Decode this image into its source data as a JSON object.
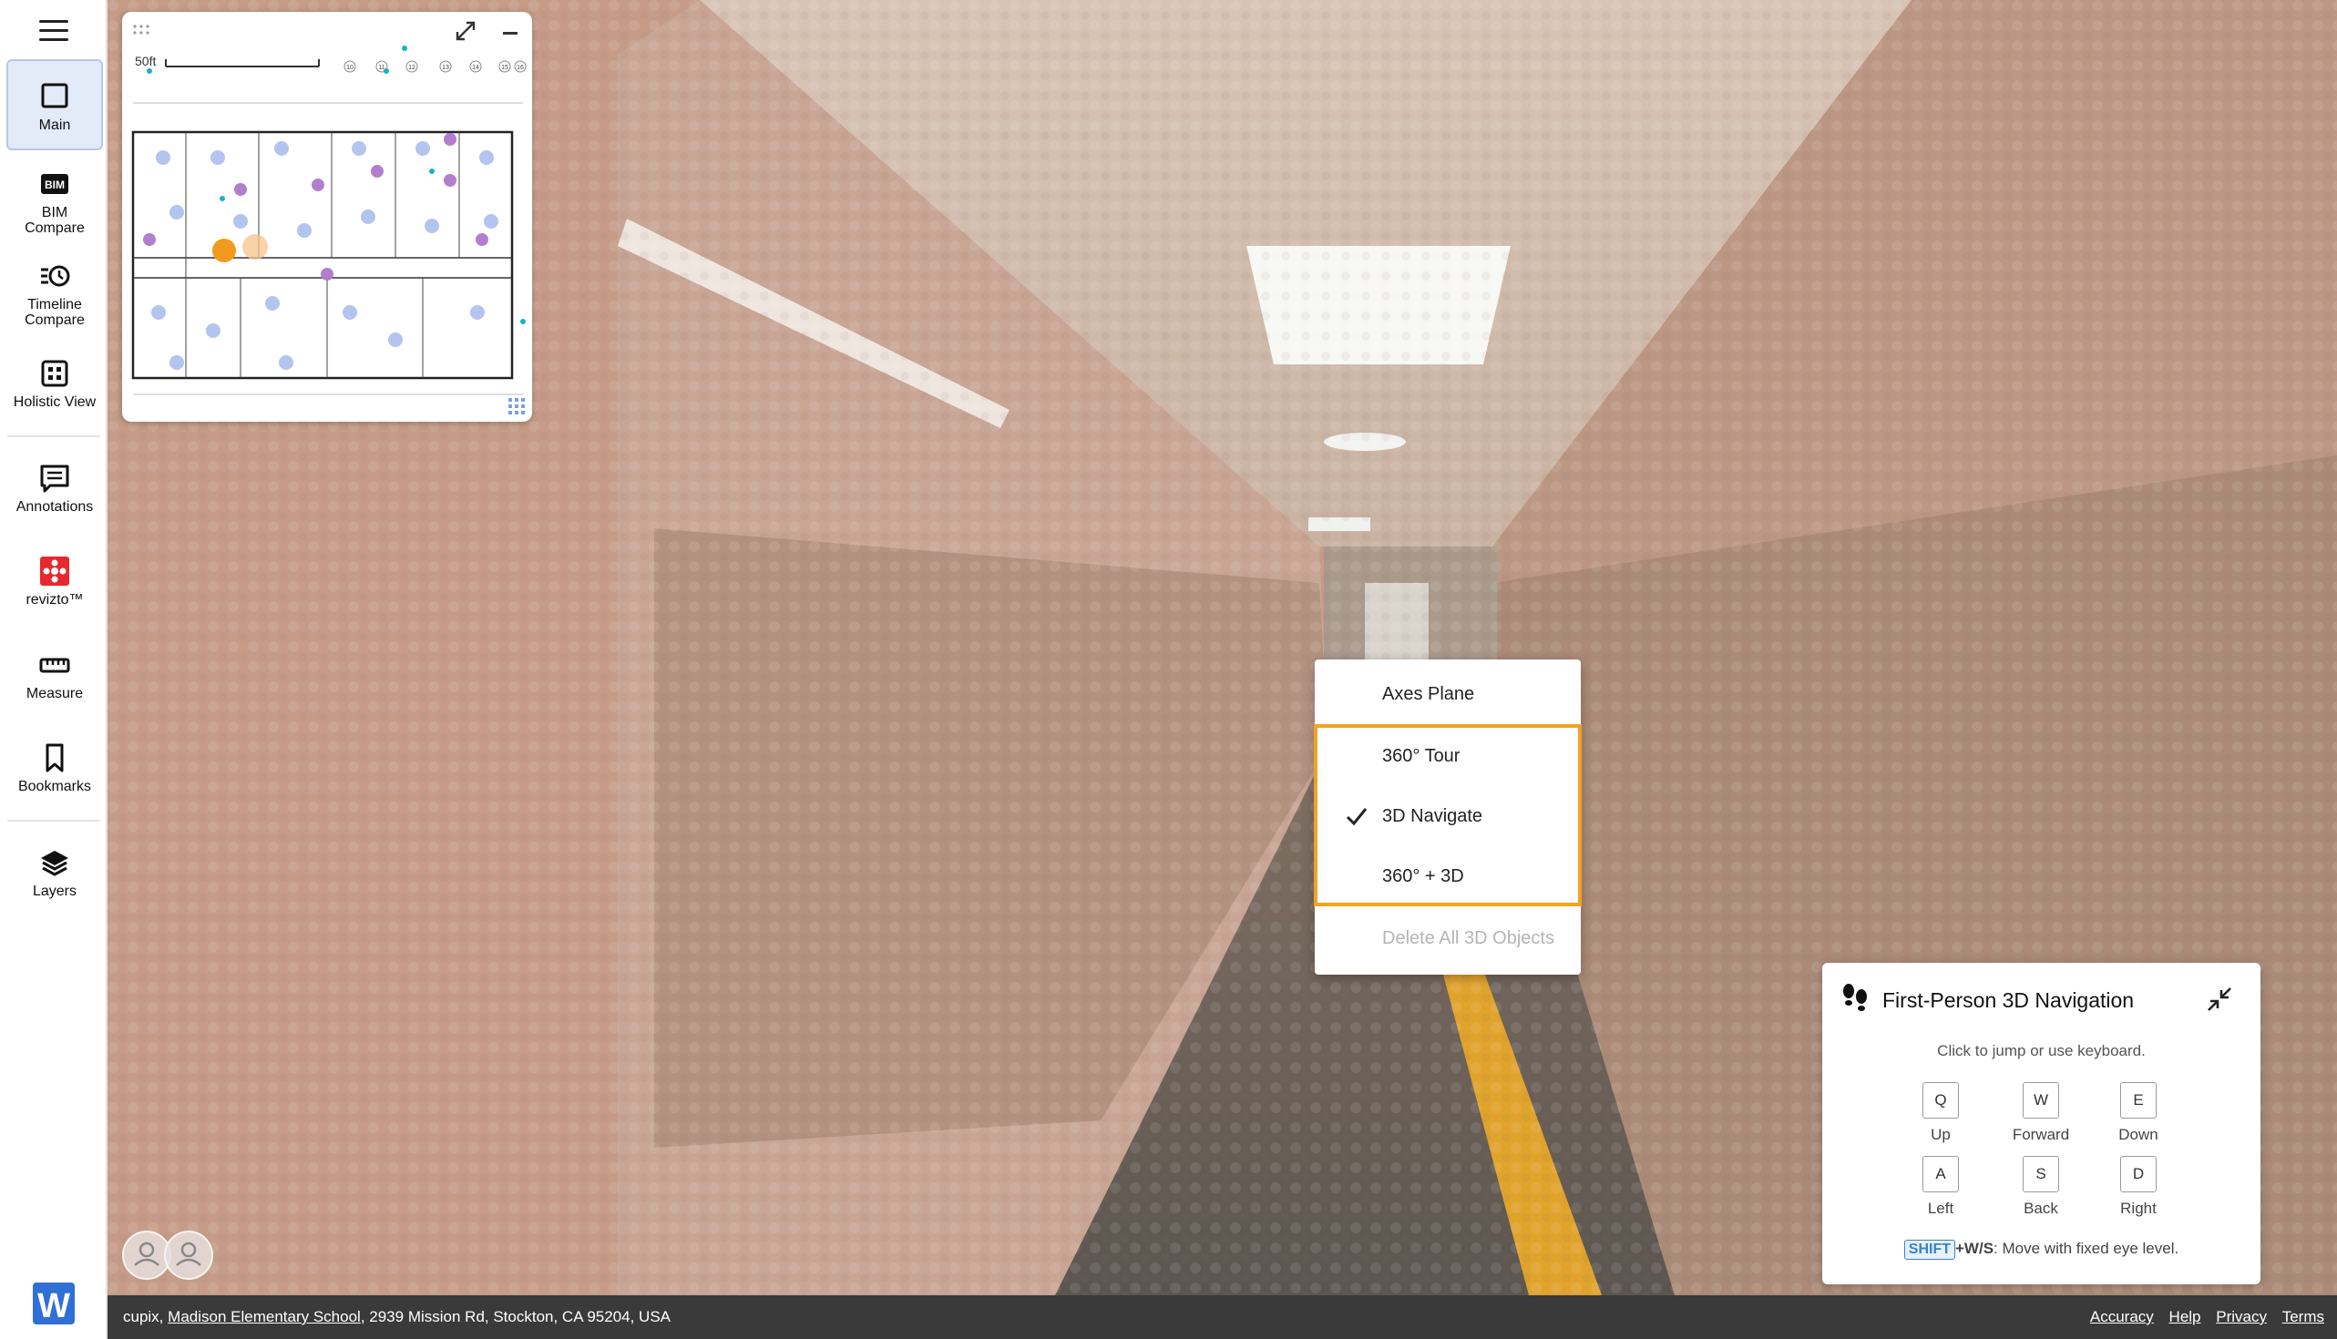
{
  "sidebar": {
    "items": [
      {
        "label": "Main",
        "icon": "square-icon"
      },
      {
        "label": "BIM\nCompare",
        "icon": "bim-icon",
        "badge": "BIM"
      },
      {
        "label": "Timeline\nCompare",
        "icon": "timeline-icon"
      },
      {
        "label": "Holistic View",
        "icon": "grid-icon"
      },
      {
        "label": "Annotations",
        "icon": "annotation-icon"
      },
      {
        "label": "revizto™",
        "icon": "revizto-icon"
      },
      {
        "label": "Measure",
        "icon": "ruler-icon"
      },
      {
        "label": "Bookmarks",
        "icon": "bookmark-icon"
      },
      {
        "label": "Layers",
        "icon": "layers-icon"
      }
    ],
    "active_index": 0,
    "logo": "W"
  },
  "minimap": {
    "scale_label": "50ft",
    "column_labels": [
      "10",
      "11",
      "12",
      "13",
      "14",
      "15",
      "16"
    ]
  },
  "context_menu": {
    "items": [
      {
        "label": "Axes Plane",
        "checked": false,
        "disabled": false
      },
      {
        "label": "360° Tour",
        "checked": false,
        "disabled": false
      },
      {
        "label": "3D Navigate",
        "checked": true,
        "disabled": false
      },
      {
        "label": "360° + 3D",
        "checked": false,
        "disabled": false
      },
      {
        "label": "Delete All 3D Objects",
        "checked": false,
        "disabled": true
      }
    ],
    "highlight_color": "#f0a324"
  },
  "nav_panel": {
    "title": "First-Person 3D Navigation",
    "hint": "Click to jump or use keyboard.",
    "keys": [
      {
        "key": "Q",
        "label": "Up"
      },
      {
        "key": "W",
        "label": "Forward"
      },
      {
        "key": "E",
        "label": "Down"
      },
      {
        "key": "A",
        "label": "Left"
      },
      {
        "key": "S",
        "label": "Back"
      },
      {
        "key": "D",
        "label": "Right"
      }
    ],
    "footer_badge": "SHIFT",
    "footer_keys": "+W/S",
    "footer_text": ": Move with fixed eye level."
  },
  "status_bar": {
    "company": "cupix,",
    "project": "Madison Elementary School",
    "address": ", 2939 Mission Rd, Stockton, CA 95204, USA",
    "links": [
      "Accuracy",
      "Help",
      "Privacy",
      "Terms"
    ]
  },
  "colors": {
    "accent": "#f0a324",
    "active_nav_bg": "#e3eaf8",
    "status_bar_bg": "#3a3a3a",
    "wall": "#c9a390",
    "floor_stripe": "#e0a32c"
  }
}
